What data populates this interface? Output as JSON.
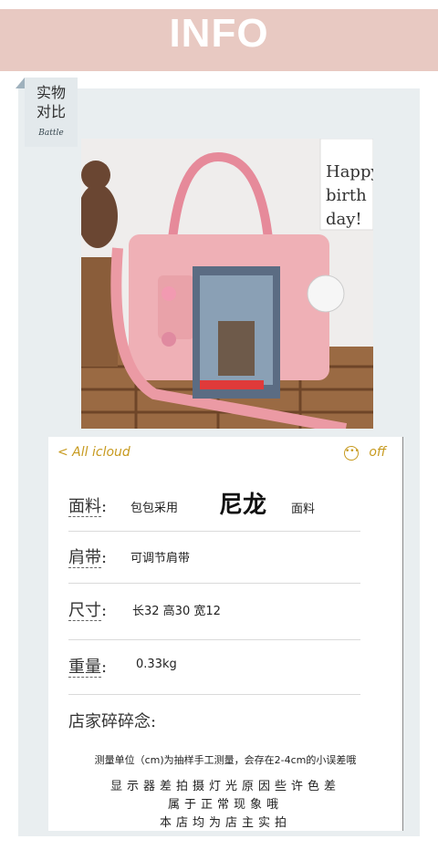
{
  "header": {
    "title": "INFO"
  },
  "badge": {
    "title_line1": "实物",
    "title_line2": "对比",
    "subtitle": "Battle"
  },
  "photo": {
    "alt": ""
  },
  "card": {
    "nav_back": "< All icloud",
    "nav_more_icon": "ellipsis-circle-icon",
    "nav_off": "off",
    "rows": [
      {
        "label": "面料",
        "colon": ":",
        "prefix": "包包采用",
        "highlight": "尼龙",
        "suffix": "面料"
      },
      {
        "label": "肩带",
        "colon": ":",
        "value": "可调节肩带"
      },
      {
        "label": "尺寸",
        "colon": ":",
        "value": "长32 高30 宽12"
      },
      {
        "label": "重量",
        "colon": ":",
        "value": "0.33kg"
      }
    ],
    "notes_label": "店家碎碎念:",
    "notes": [
      "测量单位（cm)为抽样手工测量，会存在2-4cm的小误差哦",
      "显示器差拍摄灯光原因些许色差",
      "属于正常现象哦",
      "本店均为店主实拍"
    ]
  },
  "colors": {
    "header": "#e8c9c2",
    "accent": "#c79a1f",
    "panel": "#e9eef0"
  }
}
